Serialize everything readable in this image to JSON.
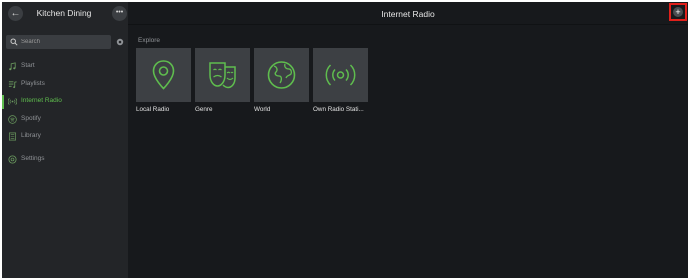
{
  "sidebar": {
    "zone_title": "Kitchen Dining",
    "search": {
      "placeholder": "Search",
      "value": ""
    },
    "items": [
      {
        "label": "Start",
        "icon": "music-note-icon",
        "active": false
      },
      {
        "label": "Playlists",
        "icon": "playlist-icon",
        "active": false
      },
      {
        "label": "Internet Radio",
        "icon": "radio-waves-icon",
        "active": true
      },
      {
        "label": "Spotify",
        "icon": "spotify-icon",
        "active": false
      },
      {
        "label": "Library",
        "icon": "library-icon",
        "active": false
      },
      {
        "label": "Settings",
        "icon": "gear-icon",
        "active": false
      }
    ]
  },
  "main": {
    "title": "Internet Radio",
    "section_label": "Explore",
    "tiles": [
      {
        "label": "Local Radio",
        "icon": "location-pin-icon"
      },
      {
        "label": "Genre",
        "icon": "theater-masks-icon"
      },
      {
        "label": "World",
        "icon": "globe-icon"
      },
      {
        "label": "Own Radio Stati...",
        "icon": "broadcast-icon"
      }
    ]
  },
  "colors": {
    "accent": "#5fbd4e",
    "highlight": "#e0201b",
    "background": "#17191c",
    "sidebar": "#232528"
  }
}
